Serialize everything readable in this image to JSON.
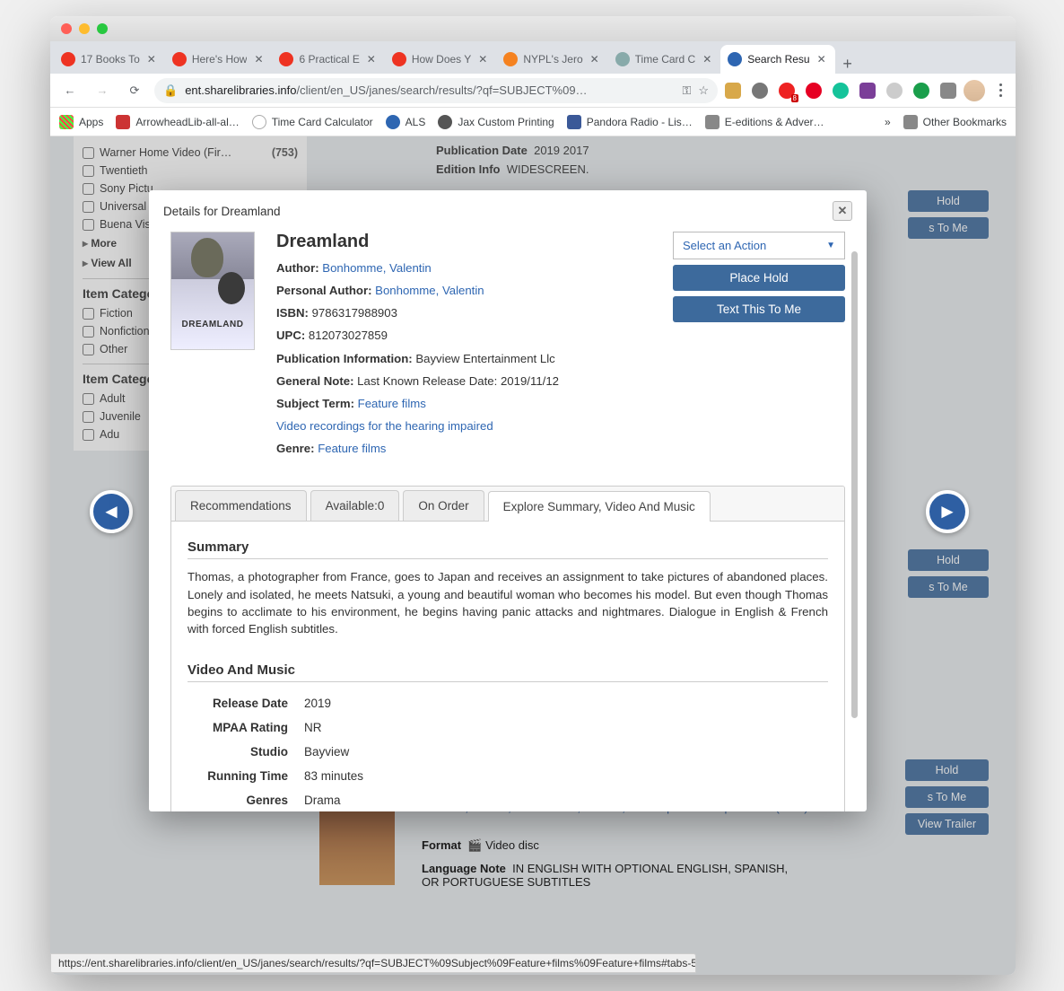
{
  "browser": {
    "tabs": [
      {
        "title": "17 Books To",
        "favicon": "#ee3322"
      },
      {
        "title": "Here's How",
        "favicon": "#ee3322"
      },
      {
        "title": "6 Practical E",
        "favicon": "#ee3322"
      },
      {
        "title": "How Does Y",
        "favicon": "#ee3322"
      },
      {
        "title": "NYPL's Jero",
        "favicon": "#f58220"
      },
      {
        "title": "Time Card C",
        "favicon": "#8aa"
      },
      {
        "title": "Search Resu",
        "favicon": "#2e66b2",
        "active": true
      }
    ],
    "url_host": "ent.sharelibraries.info",
    "url_path": "/client/en_US/janes/search/results/?qf=SUBJECT%09…",
    "bookmarks": [
      {
        "label": "Apps",
        "color": "#ccc"
      },
      {
        "label": "ArrowheadLib-all-al…",
        "color": "#c33"
      },
      {
        "label": "Time Card Calculator",
        "color": "#888"
      },
      {
        "label": "ALS",
        "color": "#2e66b2"
      },
      {
        "label": "Jax Custom Printing",
        "color": "#555"
      },
      {
        "label": "Pandora Radio - Lis…",
        "color": "#5865f2"
      },
      {
        "label": "E-editions & Adver…",
        "color": "#888"
      },
      {
        "label": "Other Bookmarks",
        "color": "#888"
      }
    ],
    "overflow": "»"
  },
  "sidebar": {
    "filters1": [
      {
        "label": "Warner Home Video (Fir…",
        "count": "(753)"
      },
      {
        "label": "Twentieth"
      },
      {
        "label": "Sony Pictu"
      },
      {
        "label": "Universal"
      },
      {
        "label": "Buena Vist"
      }
    ],
    "more": "More",
    "viewall": "View All",
    "cat_hdr": "Item Catego",
    "cats": [
      {
        "label": "Fiction"
      },
      {
        "label": "Nonfiction"
      },
      {
        "label": "Other"
      }
    ],
    "cat2_hdr": "Item Catego",
    "cats2": [
      {
        "label": "Adult"
      },
      {
        "label": "Juvenile"
      },
      {
        "label": "Adu"
      }
    ]
  },
  "background": {
    "pubdate_label": "Publication Date",
    "pubdate_val": "2019 2017",
    "edition_label": "Edition Info",
    "edition_val": "WIDESCREEN.",
    "hold": "Hold",
    "tome": "s To Me",
    "trailer": "View Trailer",
    "format_label": "Format",
    "format_val": "Video disc",
    "lang_label": "Language Note",
    "lang_val": "IN ENGLISH WITH OPTIONAL ENGLISH, SPANISH, OR PORTUGUESE SUBTITLES",
    "authors": "Medlock, Natalie, 1986-    Dixon, Russell, Motion picture adaptation of (work):"
  },
  "modal": {
    "title": "Details for Dreamland",
    "cover_text": "DREAMLAND",
    "item_title": "Dreamland",
    "author_label": "Author:",
    "author": "Bonhomme, Valentin",
    "pauthor_label": "Personal Author:",
    "pauthor": "Bonhomme, Valentin",
    "isbn_label": "ISBN:",
    "isbn": "9786317988903",
    "upc_label": "UPC:",
    "upc": "812073027859",
    "pubinfo_label": "Publication Information:",
    "pubinfo": "Bayview Entertainment Llc",
    "gnote_label": "General Note:",
    "gnote": "Last Known Release Date: 2019/11/12",
    "subj_label": "Subject Term:",
    "subj1": "Feature films",
    "subj2": "Video recordings for the hearing impaired",
    "genre_label": "Genre:",
    "genre": "Feature films",
    "select_action": "Select an Action",
    "place_hold": "Place Hold",
    "text_to_me": "Text This To Me",
    "tabs": {
      "rec": "Recommendations",
      "avail": "Available:0",
      "order": "On Order",
      "explore": "Explore Summary, Video And Music"
    },
    "summary_hdr": "Summary",
    "summary": "Thomas, a photographer from France, goes to Japan and receives an assignment to take pictures of abandoned places. Lonely and isolated, he meets Natsuki, a young and beautiful woman who becomes his model. But even though Thomas begins to acclimate to his environment, he begins having panic attacks and nightmares. Dialogue in English & French with forced English subtitles.",
    "vam_hdr": "Video And Music",
    "vam": {
      "release_k": "Release Date",
      "release_v": "2019",
      "mpaa_k": "MPAA Rating",
      "mpaa_v": "NR",
      "studio_k": "Studio",
      "studio_v": "Bayview",
      "runtime_k": "Running Time",
      "runtime_v": "83 minutes",
      "genres_k": "Genres",
      "genres_v": "Drama"
    }
  },
  "status_url": "https://ent.sharelibraries.info/client/en_US/janes/search/results/?qf=SUBJECT%09Subject%09Feature+films%09Feature+films#tabs-5"
}
